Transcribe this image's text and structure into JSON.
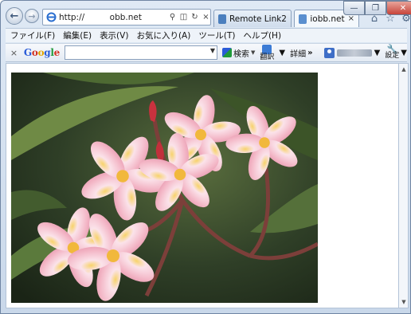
{
  "browser": {
    "address_url": "http://      obb.net   ",
    "tabs": [
      {
        "label": "Remote Link2"
      },
      {
        "label": "iobb.net"
      }
    ]
  },
  "menu": {
    "items": [
      {
        "label": "ファイル(F)"
      },
      {
        "label": "編集(E)"
      },
      {
        "label": "表示(V)"
      },
      {
        "label": "お気に入り(A)"
      },
      {
        "label": "ツール(T)"
      },
      {
        "label": "ヘルプ(H)"
      }
    ]
  },
  "google_toolbar": {
    "close_label": "×",
    "logo": [
      "G",
      "o",
      "o",
      "g",
      "l",
      "e"
    ],
    "search_value": "",
    "search_button_label": "検索",
    "translate_label": "翻訳",
    "details_label": "詳細",
    "more_label": "»",
    "settings_label": "設定"
  },
  "colors": {
    "accent": "#3b7bd5",
    "chrome": "#c9d8ea"
  }
}
